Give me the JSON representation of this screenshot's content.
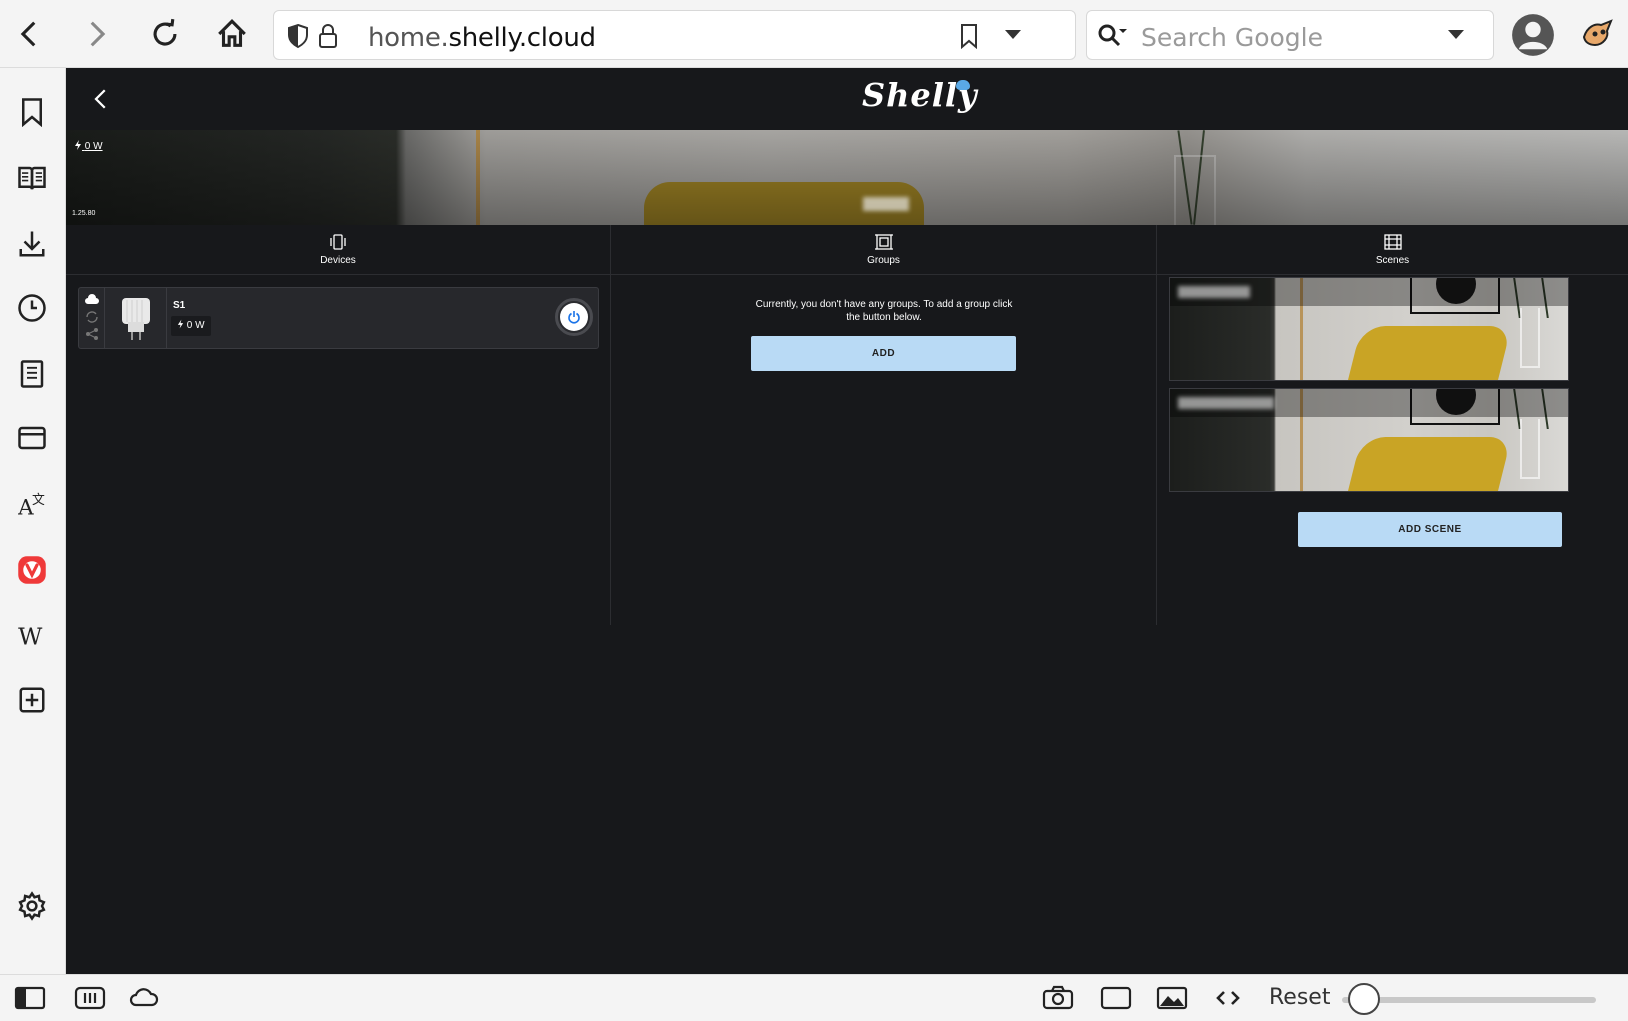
{
  "browser": {
    "url_host_prefix": "home.",
    "url_host_main": "shelly.cloud",
    "search_placeholder": "Search Google",
    "reset_label": "Reset"
  },
  "app": {
    "logo": "Shelly",
    "banner": {
      "power": "0 W",
      "version": "1.25.80"
    },
    "columns": {
      "devices_label": "Devices",
      "groups_label": "Groups",
      "scenes_label": "Scenes"
    },
    "device": {
      "name": "S1",
      "power": "0 W"
    },
    "groups": {
      "empty_message": "Currently, you don't have any groups. To add a group click the button below.",
      "add_label": "ADD"
    },
    "scenes": {
      "add_label": "ADD SCENE"
    }
  },
  "colors": {
    "app_bg": "#17181b",
    "button_bg": "#b9daf5",
    "accent": "#1a73e8"
  }
}
